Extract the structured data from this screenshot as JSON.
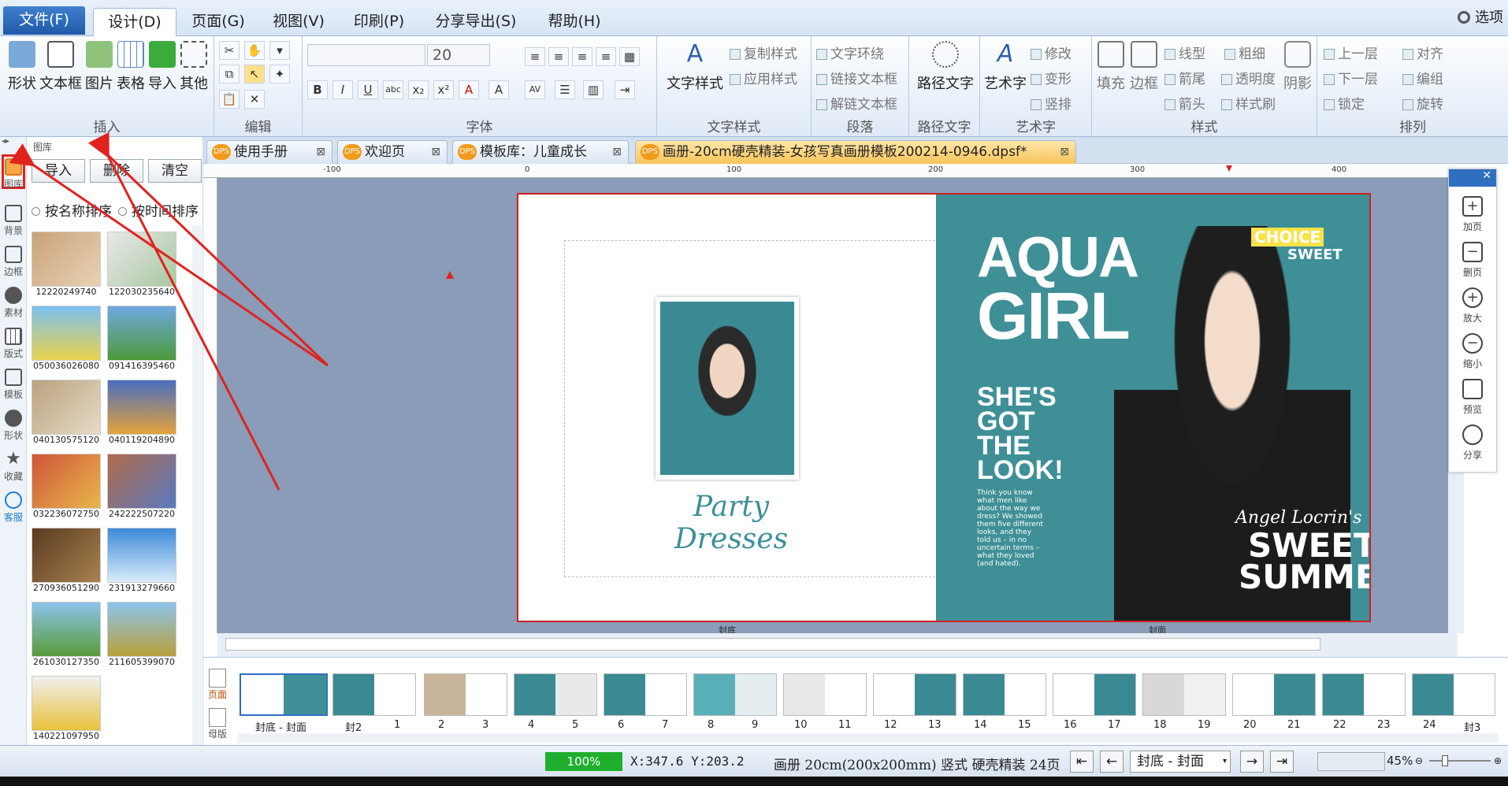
{
  "menu": {
    "items": [
      "文件(F)",
      "设计(D)",
      "页面(G)",
      "视图(V)",
      "印刷(P)",
      "分享导出(S)",
      "帮助(H)"
    ],
    "options": "选项"
  },
  "ribbon": {
    "insert": {
      "buttons": [
        "形状",
        "文本框",
        "图片",
        "表格",
        "导入",
        "其他"
      ],
      "name": "插入"
    },
    "edit": {
      "name": "编辑"
    },
    "font": {
      "size": "20",
      "name": "字体"
    },
    "textstyle": {
      "big": "文字样式",
      "copy": "复制样式",
      "apply": "应用样式",
      "name": "文字样式"
    },
    "paragraph": {
      "wrap": "文字环绕",
      "link": "链接文本框",
      "unlink": "解链文本框",
      "name": "段落"
    },
    "pathtext": {
      "big": "路径文字",
      "name": "路径文字"
    },
    "arttext": {
      "big": "艺术字",
      "modify": "修改",
      "transform": "变形",
      "vertical": "竖排",
      "name": "艺术字"
    },
    "style": {
      "fill": "填充",
      "border": "边框",
      "linetype": "线型",
      "weight": "粗细",
      "arrow1": "箭尾",
      "transparency": "透明度",
      "arrow2": "箭头",
      "brush": "样式刷",
      "shadow": "阴影",
      "name": "样式"
    },
    "arrange": {
      "up": "上一层",
      "align": "对齐",
      "down": "下一层",
      "group": "编组",
      "lock": "锁定",
      "rotate": "旋转",
      "name": "排列"
    }
  },
  "left_strip": [
    "图库",
    "背景",
    "边框",
    "素材",
    "版式",
    "模板",
    "形状",
    "收藏",
    "客服"
  ],
  "gallery": {
    "title": "图库",
    "buttons": [
      "导入",
      "删除",
      "清空"
    ],
    "sort_by_name": "按名称排序",
    "sort_by_time": "按时间排序",
    "thumbs": [
      "12220249740",
      "122030235640",
      "050036026080",
      "091416395460",
      "040130575120",
      "040119204890",
      "032236072750",
      "242222507220",
      "270936051290",
      "231913279660",
      "261030127350",
      "211605399070",
      "140221097950"
    ]
  },
  "tabs": [
    "使用手册",
    "欢迎页",
    "模板库：儿童成长",
    "画册-20cm硬壳精装-女孩写真画册模板200214-0946.dpsf*"
  ],
  "ruler": [
    "-100",
    "0",
    "100",
    "200",
    "300",
    "400"
  ],
  "page": {
    "left_caption": "Party Dresses",
    "cover_title1": "AQUA",
    "cover_title2": "GIRL",
    "cover_headline": "SHE'S GOT THE LOOK!",
    "cover_body": "Think you know what men like about the way we dress? We showed them five different looks, and they told us – in no uncertain terms – what they loved (and hated).",
    "choice": "CHOICE",
    "sweet_small": "SWEET",
    "script": "Angel Locrin's",
    "sweet_big": "SWEET",
    "summer": "SUMMER",
    "left_label": "封底",
    "right_label": "封面"
  },
  "right_tools": [
    "加页",
    "删页",
    "放大",
    "缩小",
    "预览",
    "分享"
  ],
  "page_strip": {
    "side_labels": [
      "页面",
      "母版"
    ],
    "labels": [
      "封底 - 封面",
      "封2",
      "1",
      "2",
      "3",
      "4",
      "5",
      "6",
      "7",
      "8",
      "9",
      "10",
      "11",
      "12",
      "13",
      "14",
      "15",
      "16",
      "17",
      "18",
      "19",
      "20",
      "21",
      "22",
      "23",
      "24",
      "封3"
    ]
  },
  "status": {
    "zoom": "100%",
    "coords": "X:347.6  Y:203.2",
    "info": "画册 20cm(200x200mm) 竖式 硬壳精装 24页",
    "page_select": "封底 - 封面",
    "zoom_percent": "45%"
  },
  "colors": {
    "accent": "#2f6fc0",
    "cover_bg": "#3f8f97",
    "highlight": "#e0231e",
    "zoom_green": "#1fae2e"
  }
}
